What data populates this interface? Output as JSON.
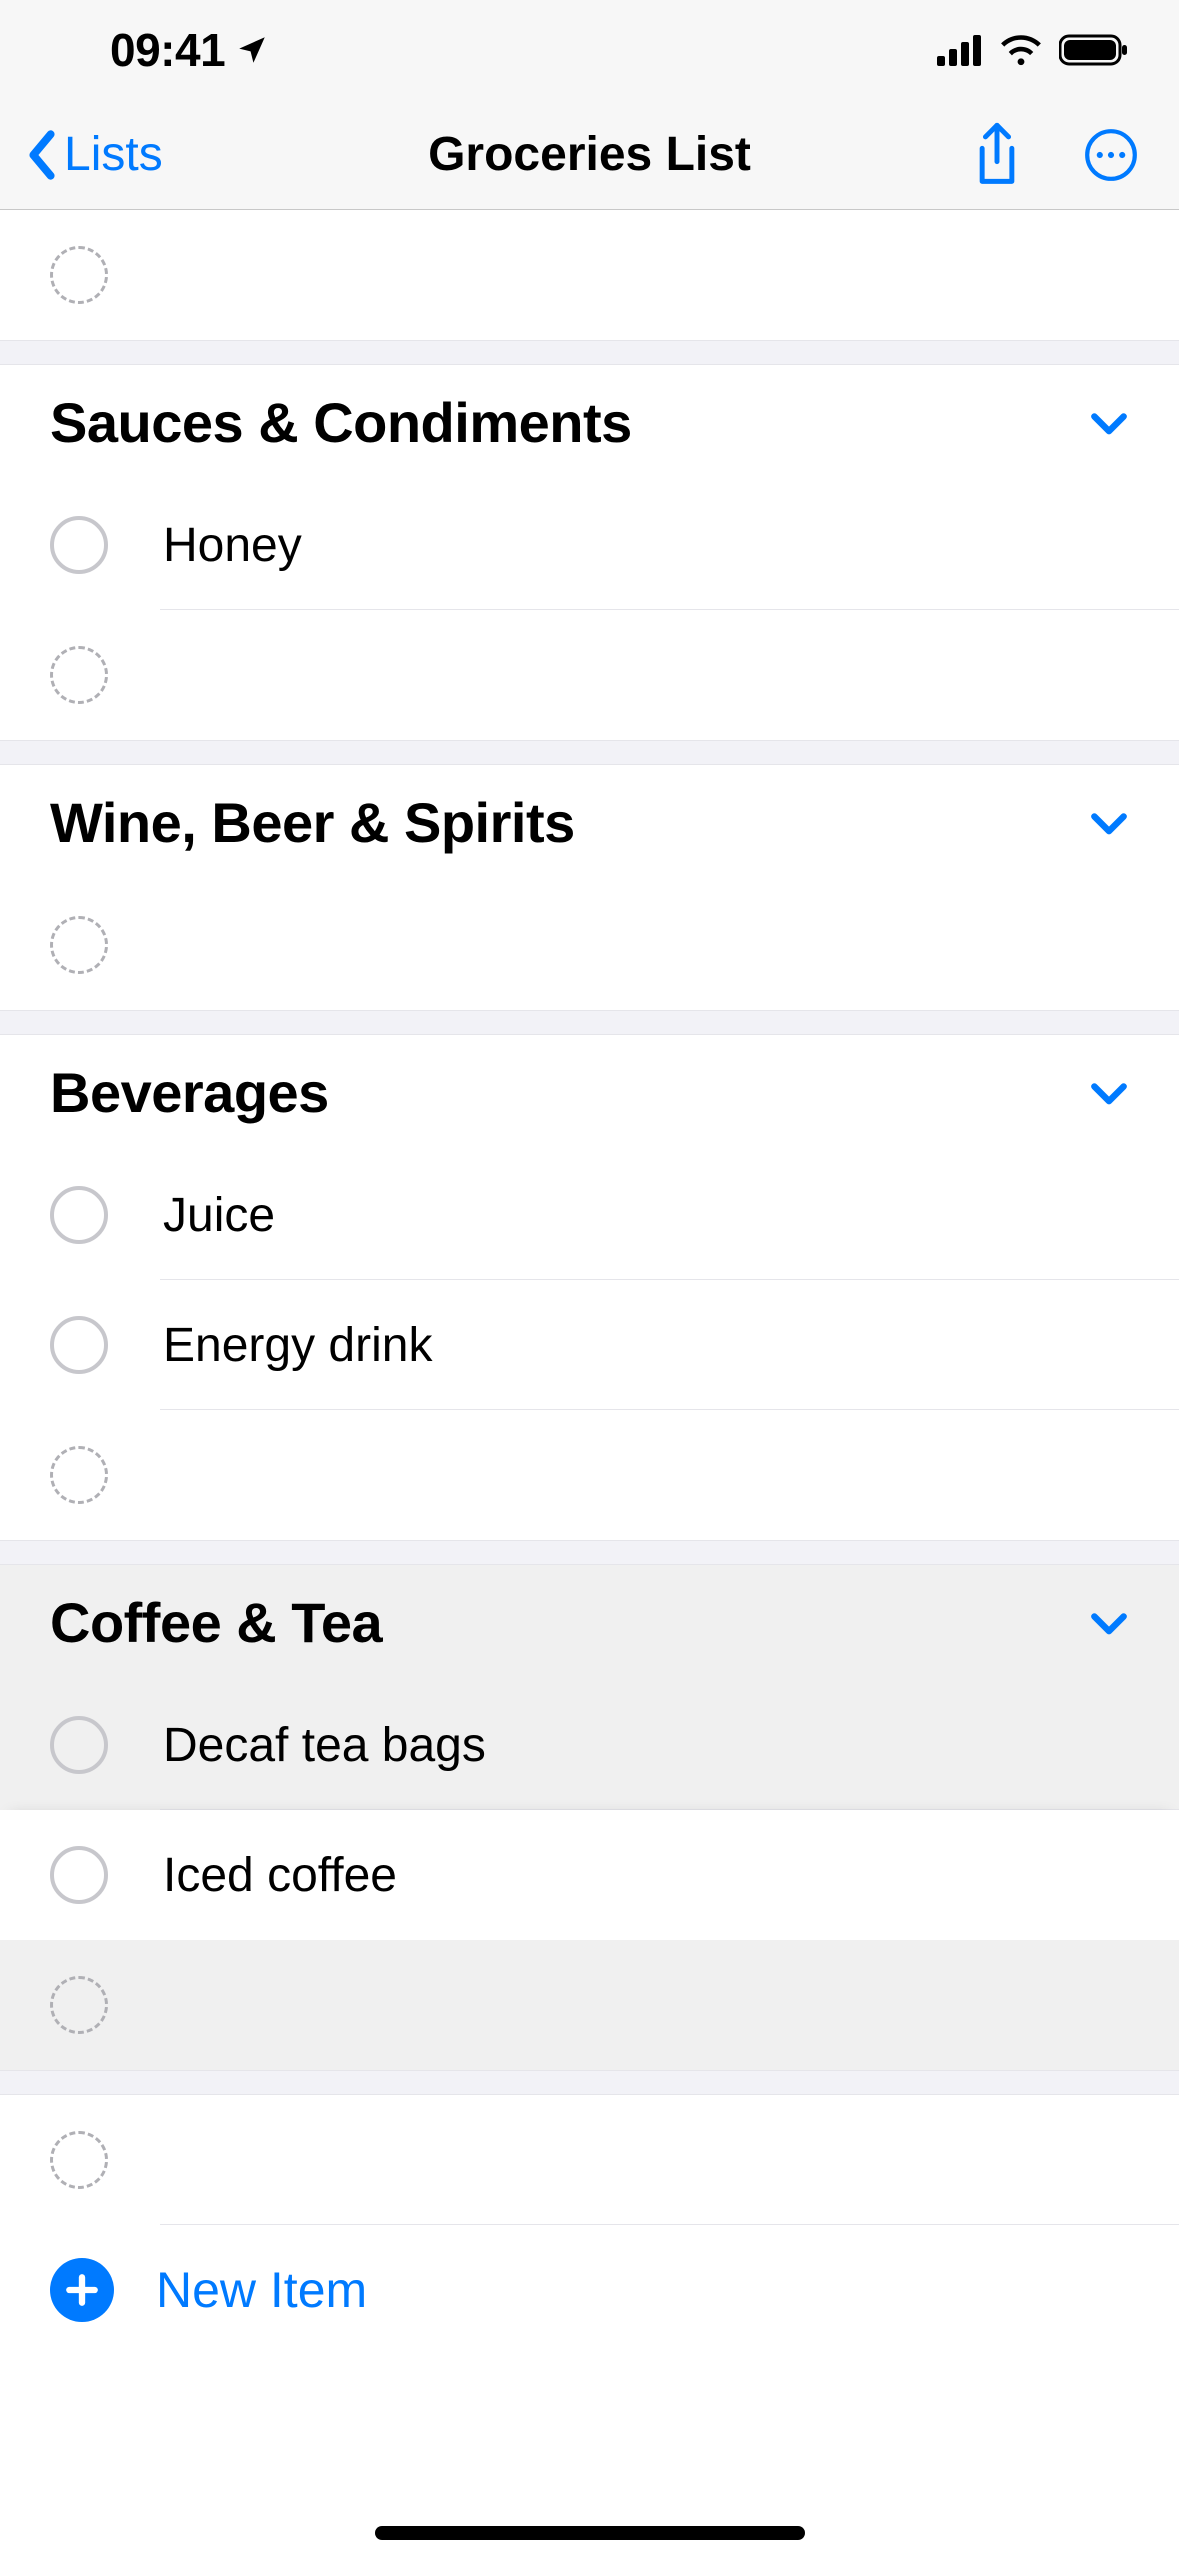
{
  "statusbar": {
    "time": "09:41"
  },
  "nav": {
    "back": "Lists",
    "title": "Groceries List"
  },
  "sections": [
    {
      "title": "Sauces & Condiments",
      "items": [
        "Honey"
      ]
    },
    {
      "title": "Wine, Beer & Spirits",
      "items": []
    },
    {
      "title": "Beverages",
      "items": [
        "Juice",
        "Energy drink"
      ]
    },
    {
      "title": "Coffee & Tea",
      "items": [
        "Decaf tea bags",
        "Iced coffee"
      ]
    }
  ],
  "newItem": "New Item",
  "colors": {
    "accent": "#007aff"
  }
}
